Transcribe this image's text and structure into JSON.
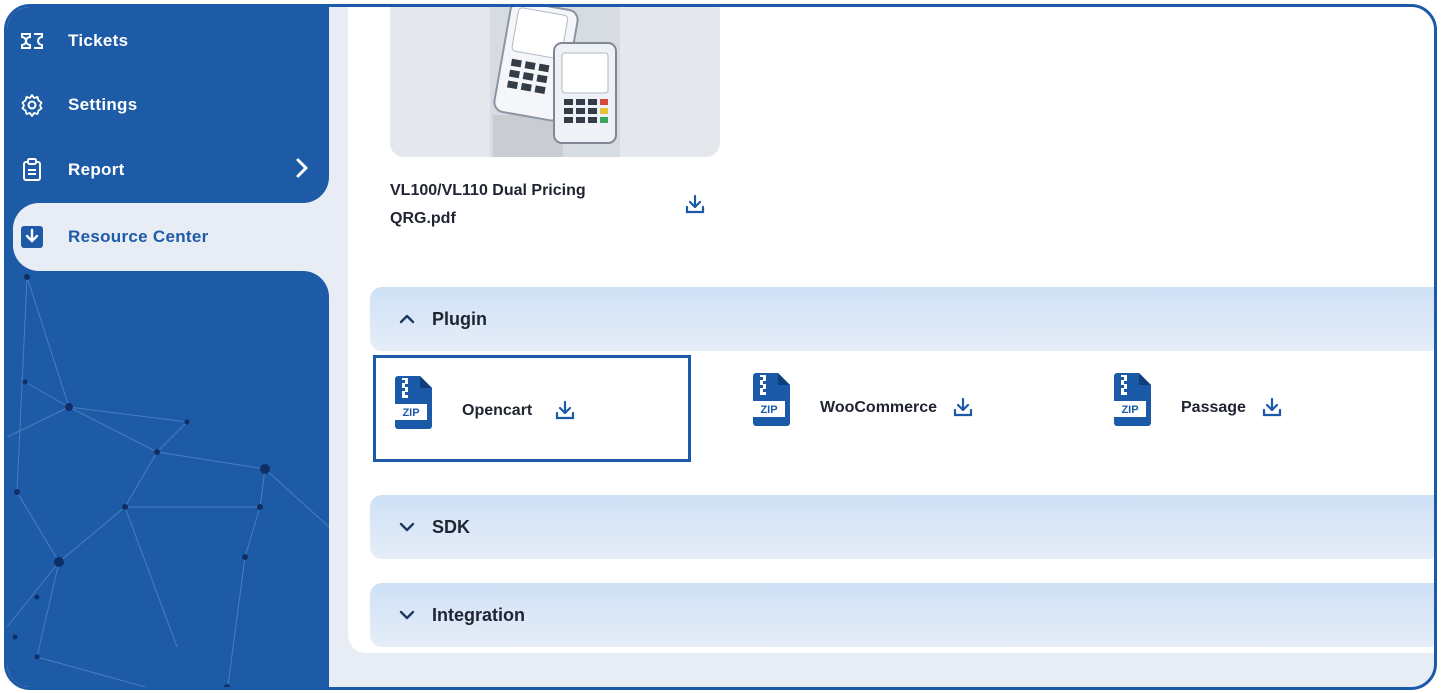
{
  "sidebar": {
    "items": [
      {
        "label": "Tickets",
        "icon": "ticket-icon"
      },
      {
        "label": "Settings",
        "icon": "gear-icon"
      },
      {
        "label": "Report",
        "icon": "clipboard-icon"
      },
      {
        "label": "Resource Center",
        "icon": "download-box-icon"
      }
    ]
  },
  "document": {
    "name_line1": "VL100/VL110 Dual Pricing",
    "name_line2": "QRG.pdf"
  },
  "sections": {
    "plugin": {
      "title": "Plugin",
      "expanded": true,
      "items": [
        {
          "name": "Opencart",
          "icon_label": "ZIP"
        },
        {
          "name": "WooCommerce",
          "icon_label": "ZIP"
        },
        {
          "name": "Passage",
          "icon_label": "ZIP"
        }
      ]
    },
    "sdk": {
      "title": "SDK",
      "expanded": false
    },
    "integration": {
      "title": "Integration",
      "expanded": false
    }
  },
  "colors": {
    "brand": "#1d5ba7",
    "accent": "#1b5aa8",
    "accordion": "#cfe0f5"
  }
}
